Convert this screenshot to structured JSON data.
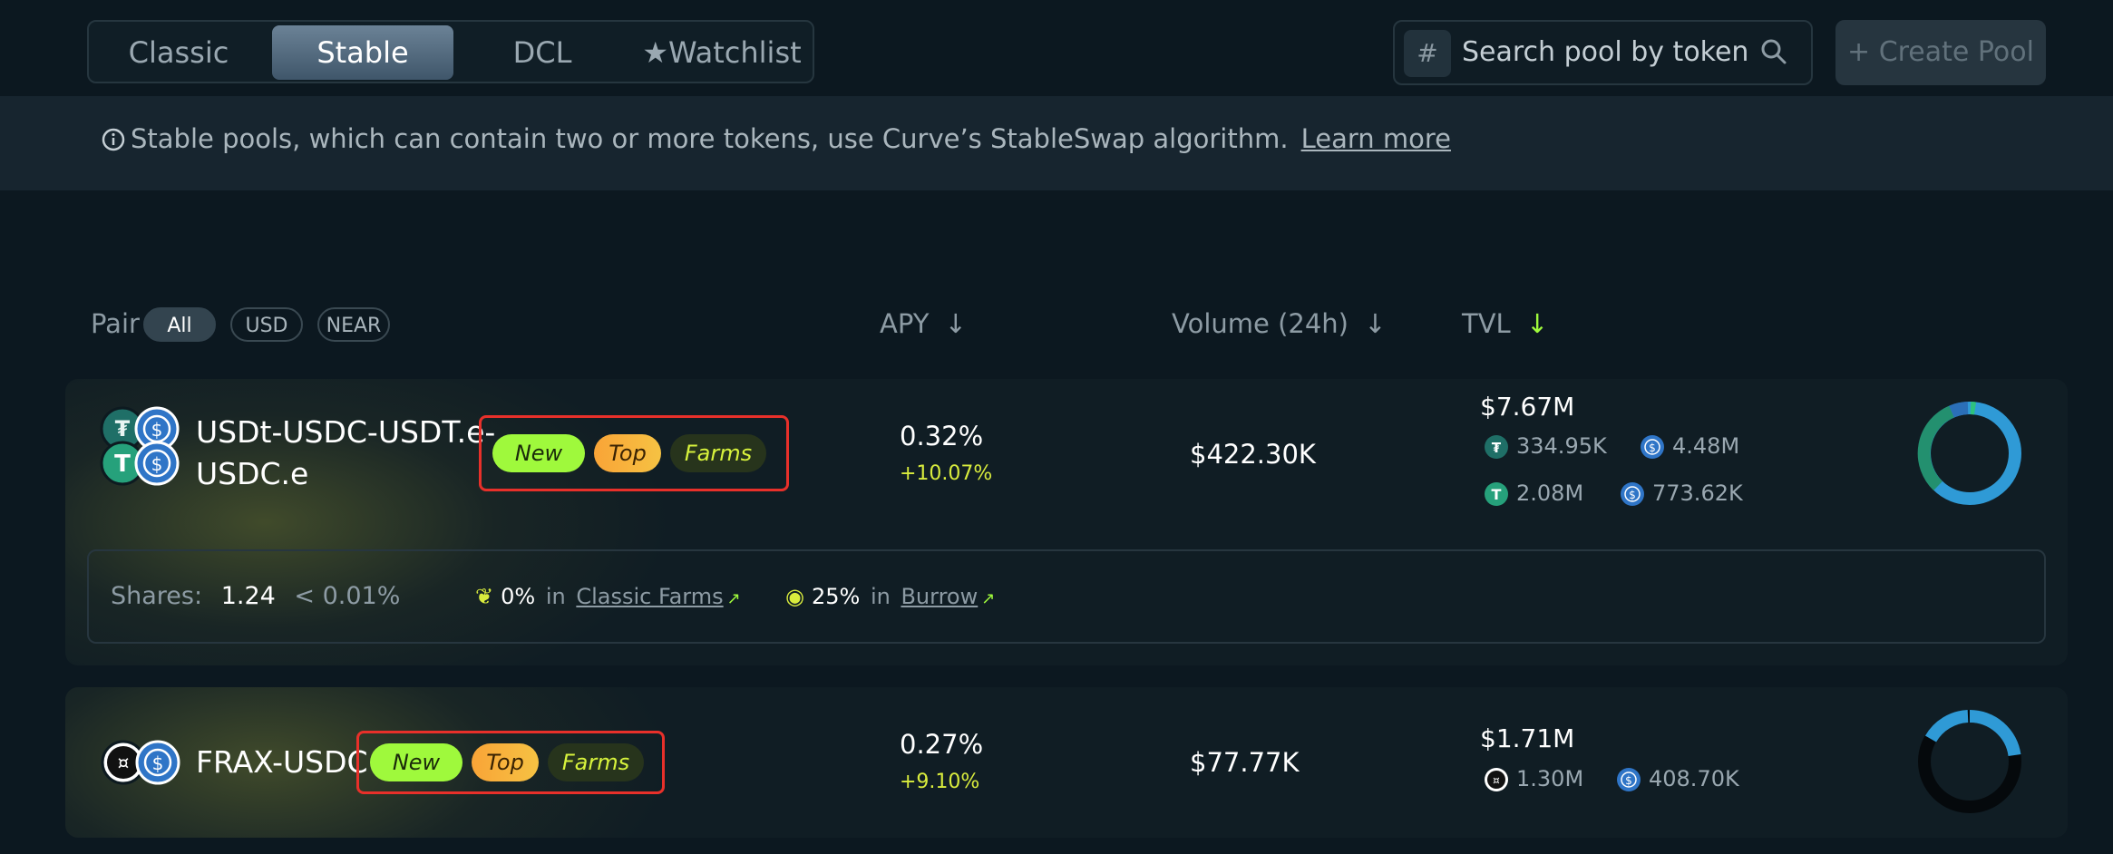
{
  "tabs": [
    "Classic",
    "Stable",
    "DCL",
    "Watchlist"
  ],
  "active_tab": "Stable",
  "search": {
    "placeholder": "Search pool by token"
  },
  "create_pool": "+ Create Pool",
  "banner": {
    "text": "Stable pools, which can contain two or more tokens, use Curve’s StableSwap algorithm.",
    "link": "Learn more"
  },
  "header": {
    "pair": "Pair",
    "filters": [
      "All",
      "USD",
      "NEAR"
    ],
    "apy": "APY",
    "volume": "Volume (24h)",
    "tvl": "TVL"
  },
  "tags": {
    "new": "New",
    "top": "Top",
    "farms": "Farms"
  },
  "pools": [
    {
      "name_line1": "USDt-USDC-USDT.e-",
      "name_line2": "USDC.e",
      "apy": "0.32%",
      "apy_change": "+10.07%",
      "volume": "$422.30K",
      "tvl": "$7.67M",
      "tvl_breakdown": [
        "334.95K",
        "4.48M",
        "2.08M",
        "773.62K"
      ],
      "shares_label": "Shares:",
      "shares_value": "1.24",
      "shares_pct": "< 0.01%",
      "farm1_pct": "0%",
      "farm1_in": "in",
      "farm1_name": "Classic Farms",
      "farm2_pct": "25%",
      "farm2_in": "in",
      "farm2_name": "Burrow"
    },
    {
      "name_line1": "FRAX-USDC",
      "apy": "0.27%",
      "apy_change": "+9.10%",
      "volume": "$77.77K",
      "tvl": "$1.71M",
      "tvl_breakdown": [
        "1.30M",
        "408.70K"
      ]
    }
  ],
  "colors": {
    "accent_green": "#9ff93c",
    "accent_yellow": "#d9ec3d",
    "highlight_red": "#e8302a"
  }
}
